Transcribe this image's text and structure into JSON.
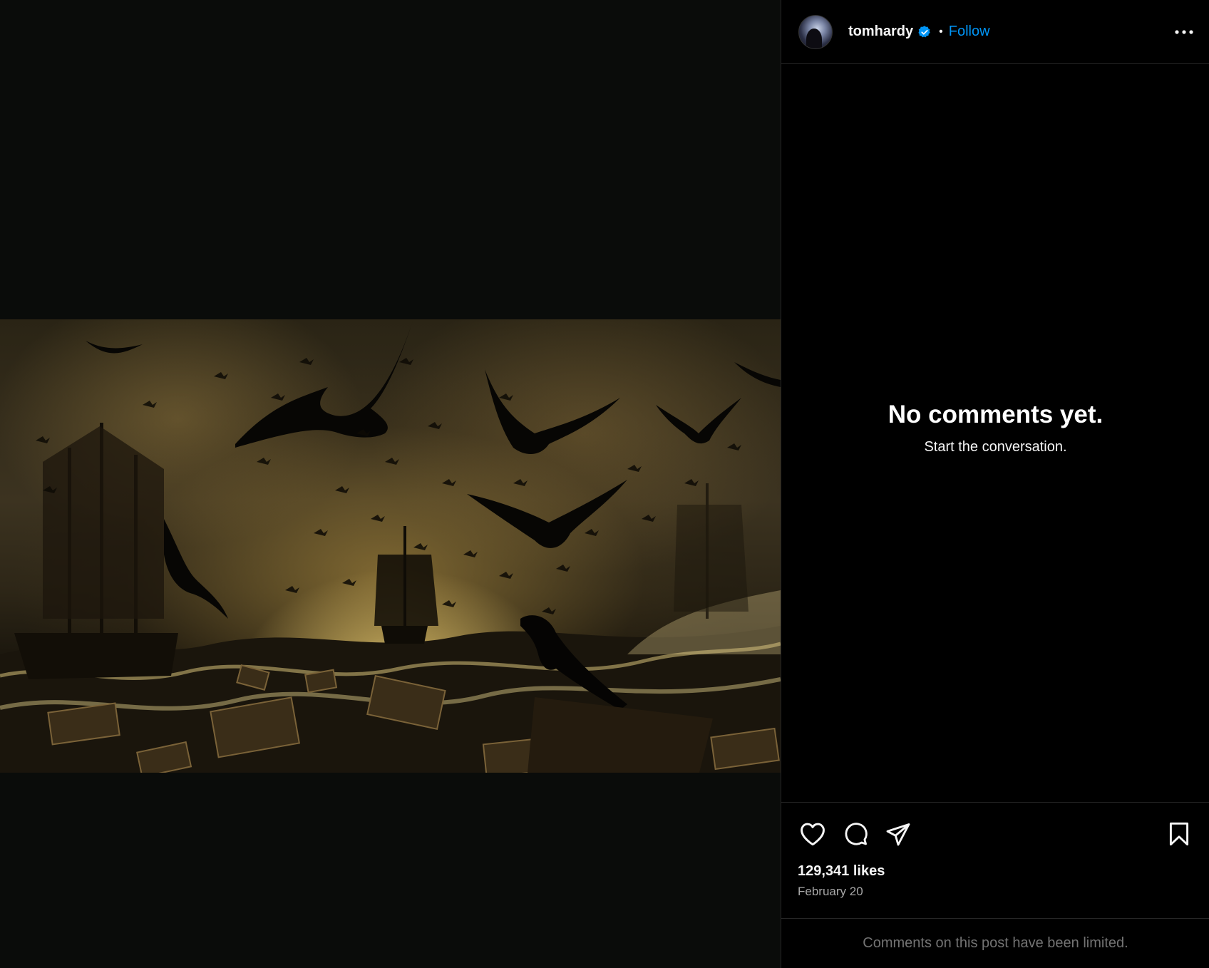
{
  "post": {
    "username": "tomhardy",
    "verified": true,
    "separator": "•",
    "follow_label": "Follow",
    "more_icon": "more-horizontal-icon",
    "media_description_icon": "image"
  },
  "comments": {
    "empty_title": "No comments yet.",
    "empty_subtitle": "Start the conversation."
  },
  "actions": {
    "like_icon": "heart-icon",
    "comment_icon": "comment-icon",
    "share_icon": "share-icon",
    "save_icon": "bookmark-icon",
    "likes": "129,341 likes",
    "date": "February 20"
  },
  "footer": {
    "limited_text": "Comments on this post have been limited."
  },
  "colors": {
    "accent": "#0095f6",
    "background": "#000000",
    "muted": "#a8a8a8",
    "divider": "#262626"
  }
}
